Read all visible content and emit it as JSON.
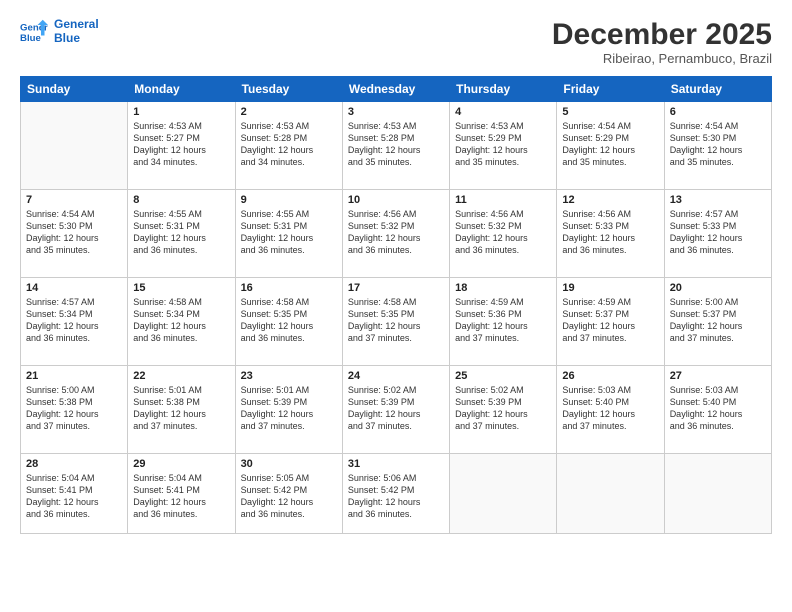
{
  "logo": {
    "line1": "General",
    "line2": "Blue"
  },
  "title": "December 2025",
  "subtitle": "Ribeirao, Pernambuco, Brazil",
  "weekdays": [
    "Sunday",
    "Monday",
    "Tuesday",
    "Wednesday",
    "Thursday",
    "Friday",
    "Saturday"
  ],
  "weeks": [
    [
      {
        "day": "",
        "info": ""
      },
      {
        "day": "1",
        "info": "Sunrise: 4:53 AM\nSunset: 5:27 PM\nDaylight: 12 hours\nand 34 minutes."
      },
      {
        "day": "2",
        "info": "Sunrise: 4:53 AM\nSunset: 5:28 PM\nDaylight: 12 hours\nand 34 minutes."
      },
      {
        "day": "3",
        "info": "Sunrise: 4:53 AM\nSunset: 5:28 PM\nDaylight: 12 hours\nand 35 minutes."
      },
      {
        "day": "4",
        "info": "Sunrise: 4:53 AM\nSunset: 5:29 PM\nDaylight: 12 hours\nand 35 minutes."
      },
      {
        "day": "5",
        "info": "Sunrise: 4:54 AM\nSunset: 5:29 PM\nDaylight: 12 hours\nand 35 minutes."
      },
      {
        "day": "6",
        "info": "Sunrise: 4:54 AM\nSunset: 5:30 PM\nDaylight: 12 hours\nand 35 minutes."
      }
    ],
    [
      {
        "day": "7",
        "info": "Sunrise: 4:54 AM\nSunset: 5:30 PM\nDaylight: 12 hours\nand 35 minutes."
      },
      {
        "day": "8",
        "info": "Sunrise: 4:55 AM\nSunset: 5:31 PM\nDaylight: 12 hours\nand 36 minutes."
      },
      {
        "day": "9",
        "info": "Sunrise: 4:55 AM\nSunset: 5:31 PM\nDaylight: 12 hours\nand 36 minutes."
      },
      {
        "day": "10",
        "info": "Sunrise: 4:56 AM\nSunset: 5:32 PM\nDaylight: 12 hours\nand 36 minutes."
      },
      {
        "day": "11",
        "info": "Sunrise: 4:56 AM\nSunset: 5:32 PM\nDaylight: 12 hours\nand 36 minutes."
      },
      {
        "day": "12",
        "info": "Sunrise: 4:56 AM\nSunset: 5:33 PM\nDaylight: 12 hours\nand 36 minutes."
      },
      {
        "day": "13",
        "info": "Sunrise: 4:57 AM\nSunset: 5:33 PM\nDaylight: 12 hours\nand 36 minutes."
      }
    ],
    [
      {
        "day": "14",
        "info": "Sunrise: 4:57 AM\nSunset: 5:34 PM\nDaylight: 12 hours\nand 36 minutes."
      },
      {
        "day": "15",
        "info": "Sunrise: 4:58 AM\nSunset: 5:34 PM\nDaylight: 12 hours\nand 36 minutes."
      },
      {
        "day": "16",
        "info": "Sunrise: 4:58 AM\nSunset: 5:35 PM\nDaylight: 12 hours\nand 36 minutes."
      },
      {
        "day": "17",
        "info": "Sunrise: 4:58 AM\nSunset: 5:35 PM\nDaylight: 12 hours\nand 37 minutes."
      },
      {
        "day": "18",
        "info": "Sunrise: 4:59 AM\nSunset: 5:36 PM\nDaylight: 12 hours\nand 37 minutes."
      },
      {
        "day": "19",
        "info": "Sunrise: 4:59 AM\nSunset: 5:37 PM\nDaylight: 12 hours\nand 37 minutes."
      },
      {
        "day": "20",
        "info": "Sunrise: 5:00 AM\nSunset: 5:37 PM\nDaylight: 12 hours\nand 37 minutes."
      }
    ],
    [
      {
        "day": "21",
        "info": "Sunrise: 5:00 AM\nSunset: 5:38 PM\nDaylight: 12 hours\nand 37 minutes."
      },
      {
        "day": "22",
        "info": "Sunrise: 5:01 AM\nSunset: 5:38 PM\nDaylight: 12 hours\nand 37 minutes."
      },
      {
        "day": "23",
        "info": "Sunrise: 5:01 AM\nSunset: 5:39 PM\nDaylight: 12 hours\nand 37 minutes."
      },
      {
        "day": "24",
        "info": "Sunrise: 5:02 AM\nSunset: 5:39 PM\nDaylight: 12 hours\nand 37 minutes."
      },
      {
        "day": "25",
        "info": "Sunrise: 5:02 AM\nSunset: 5:39 PM\nDaylight: 12 hours\nand 37 minutes."
      },
      {
        "day": "26",
        "info": "Sunrise: 5:03 AM\nSunset: 5:40 PM\nDaylight: 12 hours\nand 37 minutes."
      },
      {
        "day": "27",
        "info": "Sunrise: 5:03 AM\nSunset: 5:40 PM\nDaylight: 12 hours\nand 36 minutes."
      }
    ],
    [
      {
        "day": "28",
        "info": "Sunrise: 5:04 AM\nSunset: 5:41 PM\nDaylight: 12 hours\nand 36 minutes."
      },
      {
        "day": "29",
        "info": "Sunrise: 5:04 AM\nSunset: 5:41 PM\nDaylight: 12 hours\nand 36 minutes."
      },
      {
        "day": "30",
        "info": "Sunrise: 5:05 AM\nSunset: 5:42 PM\nDaylight: 12 hours\nand 36 minutes."
      },
      {
        "day": "31",
        "info": "Sunrise: 5:06 AM\nSunset: 5:42 PM\nDaylight: 12 hours\nand 36 minutes."
      },
      {
        "day": "",
        "info": ""
      },
      {
        "day": "",
        "info": ""
      },
      {
        "day": "",
        "info": ""
      }
    ]
  ]
}
